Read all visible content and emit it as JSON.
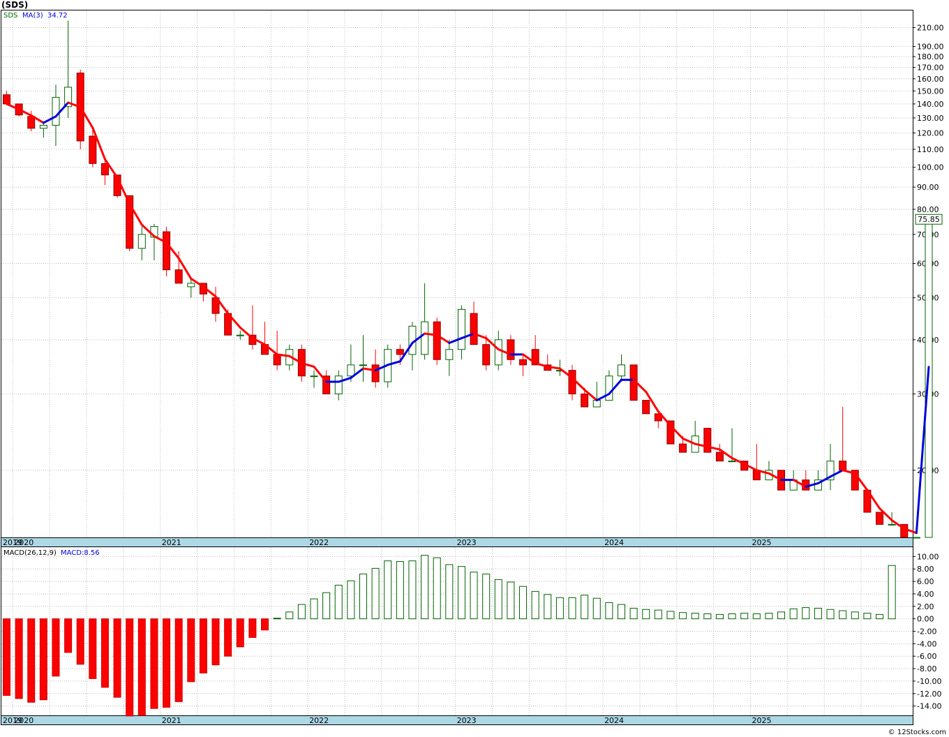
{
  "header": {
    "title": "(SDS)",
    "credit": "© 12Stocks.com"
  },
  "legend_price": {
    "symbol": "SDS",
    "ma_label": "MA(3)",
    "ma_value": "34.72"
  },
  "legend_macd": {
    "params": "MACD(26,12,9)",
    "value_label": "MACD:8.56"
  },
  "last_price_tag": "75.85",
  "colors": {
    "up": "#006400",
    "down": "#ff0000",
    "ma_up": "#0000dd",
    "ma_down": "#ff0000",
    "band": "#add8e6",
    "grid": "#bbbbbb"
  },
  "chart_data": [
    {
      "type": "candlestick",
      "scale": "log",
      "frequency": "monthly",
      "ylim": [
        14,
        230
      ],
      "y_ticks": [
        20,
        30,
        40,
        50,
        60,
        70,
        80,
        90,
        100,
        110,
        120,
        130,
        140,
        150,
        160,
        170,
        180,
        190,
        210
      ],
      "year_labels": [
        "2019",
        "2020",
        "2021",
        "2022",
        "2023",
        "2024",
        "2025"
      ],
      "x_start": "2019-12",
      "candles": [
        [
          147,
          150,
          139,
          140
        ],
        [
          140,
          140,
          131,
          132
        ],
        [
          131,
          135,
          121,
          123
        ],
        [
          123,
          126,
          117,
          125
        ],
        [
          125,
          155,
          112,
          145
        ],
        [
          138,
          218,
          130,
          153
        ],
        [
          165,
          168,
          110,
          115
        ],
        [
          118,
          123,
          100,
          102
        ],
        [
          102,
          104,
          91,
          96
        ],
        [
          96,
          96,
          85,
          86
        ],
        [
          86,
          86,
          64,
          65
        ],
        [
          65,
          73,
          61,
          70
        ],
        [
          69,
          74,
          61,
          73
        ],
        [
          71,
          73,
          56,
          58
        ],
        [
          58,
          64,
          55,
          54
        ],
        [
          53,
          55,
          50,
          54
        ],
        [
          54,
          54,
          49,
          51
        ],
        [
          50,
          53,
          44,
          46
        ],
        [
          46,
          47,
          41,
          41
        ],
        [
          41,
          42,
          40,
          41
        ],
        [
          41,
          48,
          38,
          39
        ],
        [
          39,
          44,
          37,
          37
        ],
        [
          37,
          42,
          34,
          35
        ],
        [
          35,
          39,
          34,
          38
        ],
        [
          38,
          39,
          32,
          33
        ],
        [
          33,
          34,
          31,
          33
        ],
        [
          33,
          34,
          30,
          30
        ],
        [
          30,
          34,
          29,
          33
        ],
        [
          33,
          39,
          32,
          35
        ],
        [
          35,
          41,
          32,
          35
        ],
        [
          35,
          38,
          31,
          32
        ],
        [
          32,
          39,
          31,
          38
        ],
        [
          38,
          39,
          35,
          37
        ],
        [
          37,
          44,
          34,
          43
        ],
        [
          37,
          54,
          36,
          44
        ],
        [
          44,
          45,
          35,
          36
        ],
        [
          36,
          40,
          33,
          38
        ],
        [
          38,
          48,
          36,
          47
        ],
        [
          46,
          49,
          39,
          39
        ],
        [
          39,
          41,
          34,
          35
        ],
        [
          35,
          42,
          34,
          40
        ],
        [
          40,
          41,
          35,
          36
        ],
        [
          36,
          37,
          33,
          35
        ],
        [
          38,
          41,
          35,
          35
        ],
        [
          35,
          37,
          34,
          34
        ],
        [
          34,
          36,
          33,
          34
        ],
        [
          34,
          35,
          29,
          30
        ],
        [
          30,
          31,
          28,
          28
        ],
        [
          28,
          32,
          28,
          29
        ],
        [
          29,
          34,
          29,
          33
        ],
        [
          33,
          37,
          32,
          35
        ],
        [
          35,
          35,
          29,
          29
        ],
        [
          29,
          29,
          27,
          27
        ],
        [
          27,
          27,
          25,
          26
        ],
        [
          26,
          26,
          23,
          23
        ],
        [
          23,
          24,
          22,
          22
        ],
        [
          22,
          26,
          22,
          24
        ],
        [
          25,
          25,
          22,
          22
        ],
        [
          22,
          23,
          21,
          21
        ],
        [
          21,
          25,
          21,
          21
        ],
        [
          21,
          21,
          20,
          20
        ],
        [
          20,
          23,
          19,
          19
        ],
        [
          19,
          21,
          19,
          20
        ],
        [
          20,
          20,
          18,
          18
        ],
        [
          18,
          20,
          18,
          19
        ],
        [
          19,
          20,
          18,
          18
        ],
        [
          18,
          20,
          18,
          19
        ],
        [
          19,
          23,
          18,
          21
        ],
        [
          21,
          28,
          20,
          20
        ],
        [
          20,
          20,
          18,
          18
        ],
        [
          18,
          18,
          16,
          16
        ],
        [
          16,
          16,
          15,
          15
        ],
        [
          15,
          16,
          15,
          15
        ],
        [
          15,
          15,
          14,
          14
        ],
        [
          14,
          14,
          14,
          14
        ],
        [
          14,
          76,
          14,
          75.85
        ]
      ]
    },
    {
      "type": "bar",
      "name": "MACD(26,12,9)",
      "ylim": [
        -15.5,
        11.5
      ],
      "y_ticks": [
        -14,
        -12,
        -10,
        -8,
        -6,
        -4,
        -2,
        0,
        2,
        4,
        6,
        8,
        10
      ],
      "year_labels": [
        "2019",
        "2020",
        "2021",
        "2022",
        "2023",
        "2024",
        "2025"
      ],
      "values": [
        -12.3,
        -12.8,
        -13.4,
        -13.0,
        -9.2,
        -5.4,
        -7.3,
        -9.6,
        -11.0,
        -12.6,
        -15.6,
        -15.5,
        -14.4,
        -14.2,
        -13.3,
        -10.1,
        -8.7,
        -7.4,
        -6.0,
        -4.5,
        -3.0,
        -1.8,
        0.1,
        1.1,
        2.3,
        3.2,
        4.2,
        5.4,
        6.1,
        7.2,
        8.1,
        9.3,
        9.2,
        9.3,
        10.2,
        9.8,
        8.7,
        8.4,
        7.5,
        7.2,
        6.3,
        5.9,
        5.2,
        4.4,
        3.9,
        3.4,
        3.4,
        3.8,
        3.3,
        2.6,
        2.3,
        1.7,
        1.5,
        1.4,
        1.2,
        1.0,
        0.9,
        0.8,
        0.7,
        0.8,
        0.9,
        0.8,
        0.9,
        1.1,
        1.6,
        1.8,
        1.7,
        1.5,
        1.3,
        1.1,
        0.9,
        0.7,
        8.56
      ]
    }
  ]
}
